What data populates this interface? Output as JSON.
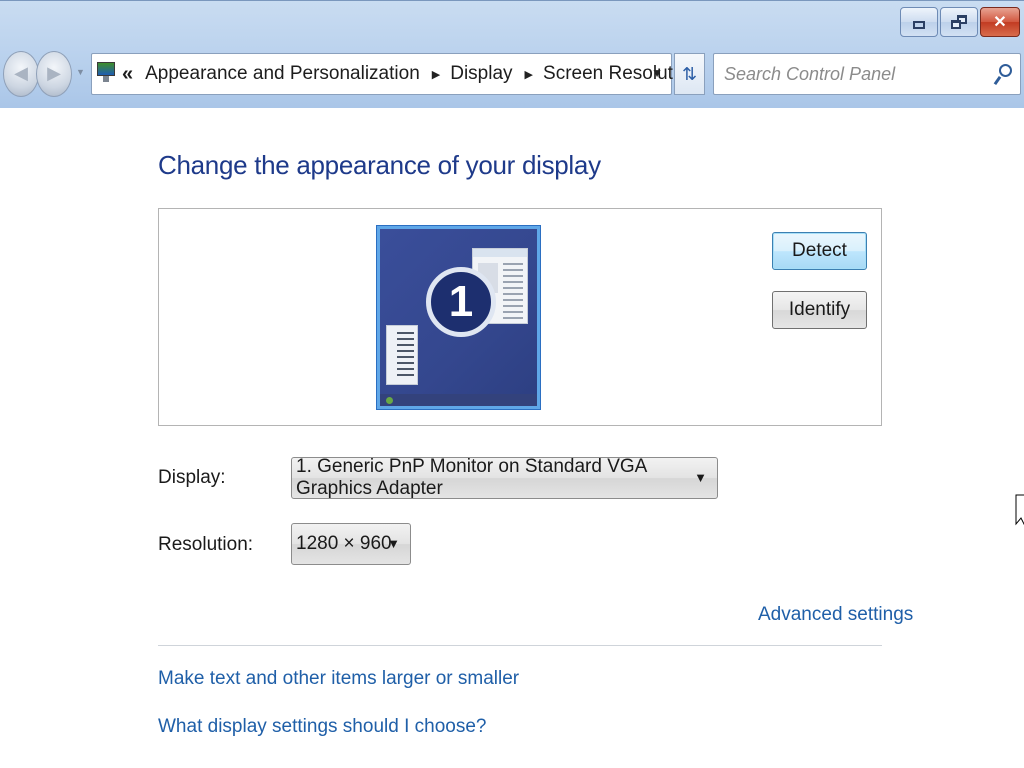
{
  "window": {
    "caption_buttons": {
      "minimize": "minimize-icon",
      "maximize": "restore-icon",
      "close": "close-icon"
    }
  },
  "nav": {
    "back_icon": "back-arrow-icon",
    "forward_icon": "forward-arrow-icon",
    "address": {
      "icon": "control-panel-icon",
      "overflow": "«",
      "crumbs": [
        "Appearance and Personalization",
        "Display",
        "Screen Resolution"
      ]
    },
    "refresh_icon": "refresh-icon",
    "search": {
      "placeholder": "Search Control Panel",
      "icon": "search-icon"
    }
  },
  "main": {
    "heading": "Change the appearance of your display",
    "preview": {
      "monitor_number": "1",
      "detect_label": "Detect",
      "identify_label": "Identify"
    },
    "display": {
      "label": "Display:",
      "value": "1. Generic PnP Monitor on Standard VGA Graphics Adapter"
    },
    "resolution": {
      "label": "Resolution:",
      "value": "1280 × 960"
    },
    "links": {
      "advanced": "Advanced settings",
      "larger": "Make text and other items larger or smaller",
      "which": "What display settings should I choose?"
    }
  },
  "colors": {
    "heading": "#1e3a8a",
    "link": "#1f5fa8",
    "chrome": "#bcd3ee",
    "close_button": "#c23b22"
  }
}
